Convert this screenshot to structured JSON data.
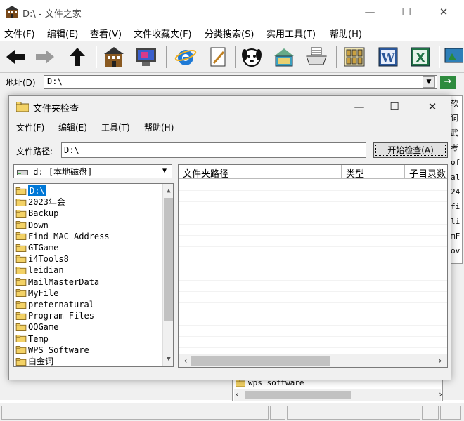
{
  "window": {
    "title": "D:\\ - 文件之家",
    "minimize": "—",
    "maximize": "☐",
    "close": "✕"
  },
  "menu": [
    "文件(F)",
    "编辑(E)",
    "查看(V)",
    "文件收藏夹(F)",
    "分类搜索(S)",
    "实用工具(T)",
    "帮助(H)"
  ],
  "toolbar_icons": [
    "back-arrow-icon",
    "forward-arrow-icon",
    "up-arrow-icon",
    "home-building-icon",
    "monitor-icon",
    "internet-explorer-icon",
    "file-edit-icon",
    "search-dog-icon",
    "network-folder-icon",
    "printer-icon",
    "folders-grid-icon",
    "word-icon",
    "excel-icon",
    "desktop-icon"
  ],
  "address": {
    "label": "地址(D)",
    "value": "D:\\"
  },
  "right_strip": [
    "软",
    "词",
    "武",
    "考",
    "of",
    "al",
    "24",
    "fi",
    "li",
    "mF",
    "ov"
  ],
  "back_panel": {
    "text": "wps software"
  },
  "dialog": {
    "title": "文件夹检查",
    "minimize": "—",
    "maximize": "☐",
    "close": "✕",
    "menu": [
      "文件(F)",
      "编辑(E)",
      "工具(T)",
      "帮助(H)"
    ],
    "path_label": "文件路径:",
    "path_value": "D:\\",
    "start_button": "开始检查(A)",
    "drive": "d: [本地磁盘]",
    "tree": [
      "D:\\",
      "2023年会",
      "Backup",
      "Down",
      "Find MAC Address",
      "GTGame",
      "i4Tools8",
      "leidian",
      "MailMasterData",
      "MyFile",
      "preternatural",
      "Program Files",
      "QQGame",
      "Temp",
      "WPS Software",
      "白金词"
    ],
    "selected_index": 0,
    "columns": [
      "文件夹路径",
      "类型",
      "子目录数"
    ]
  }
}
